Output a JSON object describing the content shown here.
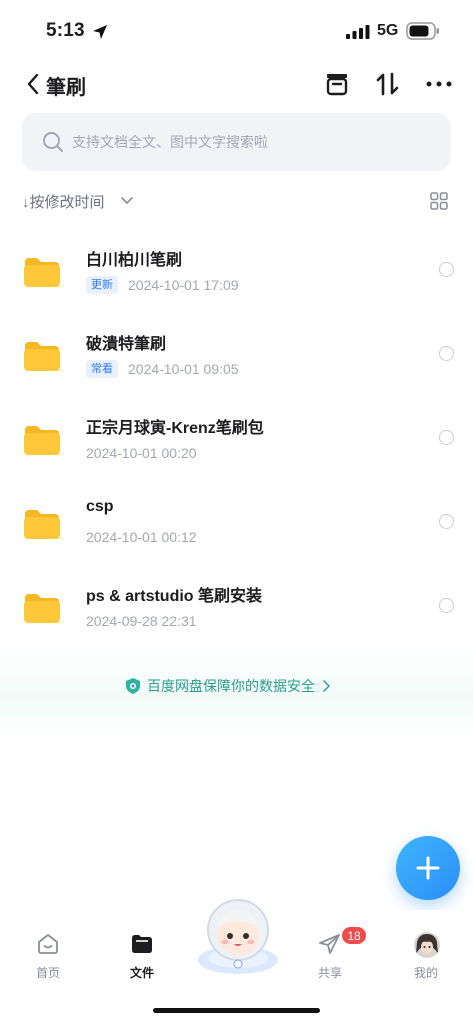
{
  "status_bar": {
    "time": "5:13",
    "network": "5G"
  },
  "header": {
    "title": "筆刷"
  },
  "search": {
    "placeholder": "支持文档全文、图中文字搜索啦"
  },
  "sort": {
    "label": "↓按修改时间"
  },
  "files": [
    {
      "name": "白川柏川笔刷",
      "badge": "更新",
      "time": "2024-10-01 17:09"
    },
    {
      "name": "破潰特筆刷",
      "badge": "常看",
      "time": "2024-10-01 09:05"
    },
    {
      "name": "正宗月球寅-Krenz笔刷包",
      "badge": "",
      "time": "2024-10-01 00:20"
    },
    {
      "name": "csp",
      "badge": "",
      "time": "2024-10-01 00:12"
    },
    {
      "name": "ps & artstudio 笔刷安装",
      "badge": "",
      "time": "2024-09-28 22:31"
    }
  ],
  "security_banner": {
    "text": "百度网盘保障你的数据安全"
  },
  "tab_bar": {
    "items": [
      {
        "label": "首页",
        "icon": "home-smile-icon"
      },
      {
        "label": "文件",
        "icon": "folder-icon"
      },
      {
        "label": "共享",
        "icon": "paper-plane-icon"
      },
      {
        "label": "我的",
        "icon": "avatar"
      }
    ],
    "share_badge": "18"
  },
  "colors": {
    "accent": "#2f7cf6",
    "security": "#2a9d8f",
    "badge_red": "#f04b4b",
    "folder": "#ffc83a"
  }
}
